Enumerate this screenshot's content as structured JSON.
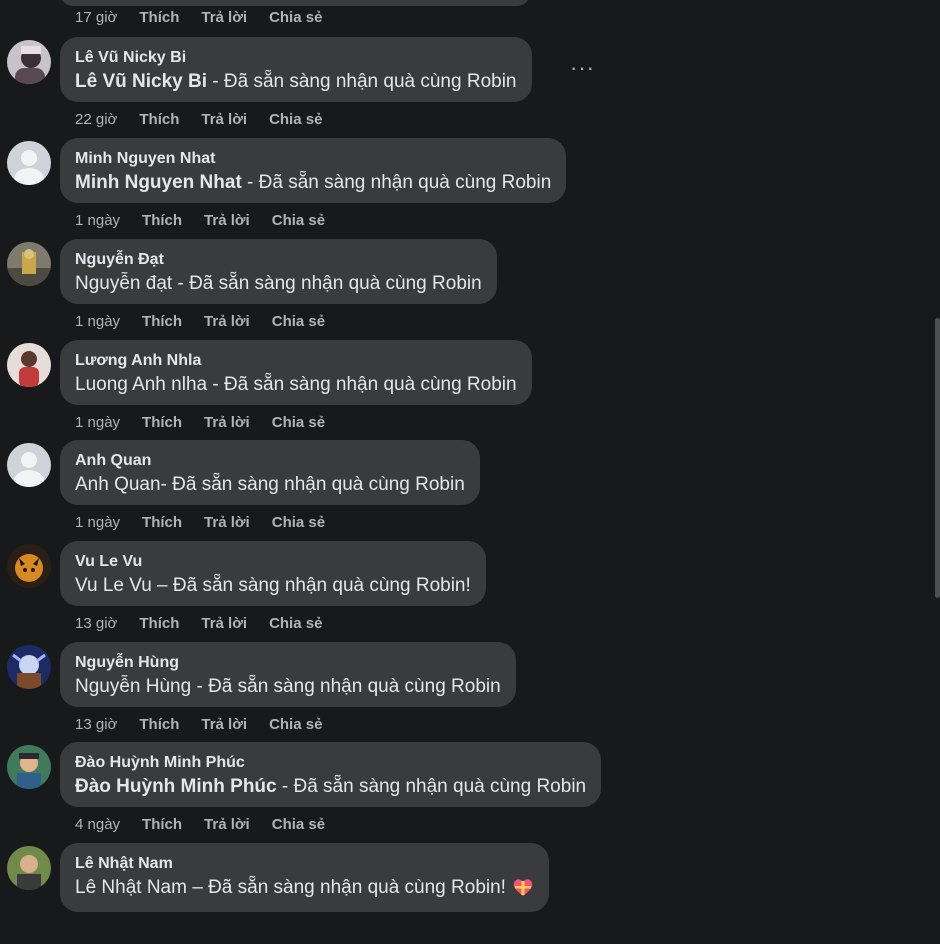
{
  "colors": {
    "bg": "#18191a",
    "bubble": "#3a3b3c",
    "text": "#e4e6eb",
    "muted": "#b0b3b8"
  },
  "top_actions": {
    "time": "17 giờ",
    "like": "Thích",
    "reply": "Trả lời",
    "share": "Chia sẻ"
  },
  "comments": [
    {
      "author": "Lê Vũ Nicky Bi",
      "text_prefix": "Lê Vũ Nicky Bi",
      "text": " - Đã sẵn sàng nhận quà cùng Robin",
      "time": "22 giờ",
      "like": "Thích",
      "reply": "Trả lời",
      "share": "Chia sẻ",
      "more": "···",
      "avatar": "photo-avatar"
    },
    {
      "author": "Minh Nguyen Nhat",
      "text_prefix": "Minh Nguyen Nhat",
      "text": " - Đã sẵn sàng nhận quà cùng Robin",
      "time": "1 ngày",
      "like": "Thích",
      "reply": "Trả lời",
      "share": "Chia sẻ",
      "avatar": "default-avatar"
    },
    {
      "author": "Nguyễn Đạt",
      "text": "Nguyễn đạt - Đã sẵn sàng nhận quà cùng Robin",
      "time": "1 ngày",
      "like": "Thích",
      "reply": "Trả lời",
      "share": "Chia sẻ",
      "avatar": "photo-avatar"
    },
    {
      "author": "Lương Anh Nhla",
      "text": "Luong Anh nlha - Đã sẵn sàng nhận quà cùng Robin",
      "time": "1 ngày",
      "like": "Thích",
      "reply": "Trả lời",
      "share": "Chia sẻ",
      "avatar": "photo-avatar"
    },
    {
      "author": "Anh Quan",
      "text": "Anh Quan- Đã sẵn sàng nhận quà cùng Robin",
      "time": "1 ngày",
      "like": "Thích",
      "reply": "Trả lời",
      "share": "Chia sẻ",
      "avatar": "default-avatar"
    },
    {
      "author": "Vu Le Vu",
      "text": "Vu Le Vu – Đã sẵn sàng nhận quà cùng Robin!",
      "time": "13 giờ",
      "like": "Thích",
      "reply": "Trả lời",
      "share": "Chia sẻ",
      "avatar": "photo-avatar"
    },
    {
      "author": "Nguyễn Hùng",
      "text": "Nguyễn Hùng - Đã sẵn sàng nhận quà cùng Robin",
      "time": "13 giờ",
      "like": "Thích",
      "reply": "Trả lời",
      "share": "Chia sẻ",
      "avatar": "photo-avatar"
    },
    {
      "author": "Đào Huỳnh Minh Phúc",
      "text_prefix": "Đào Huỳnh Minh Phúc",
      "text": " - Đã sẵn sàng nhận quà cùng Robin",
      "time": "4 ngày",
      "like": "Thích",
      "reply": "Trả lời",
      "share": "Chia sẻ",
      "avatar": "photo-avatar"
    },
    {
      "author": "Lê Nhật Nam",
      "text": "Lê Nhật Nam – Đã sẵn sàng nhận quà cùng Robin!",
      "time": "",
      "like": "",
      "reply": "",
      "share": "",
      "avatar": "photo-avatar",
      "emoji": "gift-heart-icon"
    }
  ]
}
